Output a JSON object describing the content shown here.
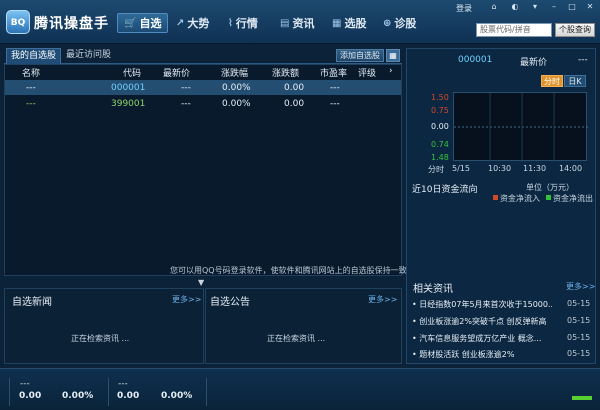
{
  "app": {
    "title": "腾讯操盘手",
    "logo_text": "BQ"
  },
  "topbar": {
    "login": "登录",
    "nav": [
      {
        "label": "自选",
        "icon": "cart"
      },
      {
        "label": "大势",
        "icon": "trend"
      },
      {
        "label": "行情",
        "icon": "chart"
      },
      {
        "label": "资讯",
        "icon": "news"
      },
      {
        "label": "选股",
        "icon": "grid"
      },
      {
        "label": "诊股",
        "icon": "plus"
      }
    ],
    "search_placeholder": "股票代码/拼音",
    "search_button": "个股查询"
  },
  "watchlist": {
    "tabs": [
      "我的自选股",
      "最近访问股"
    ],
    "add_button": "添加自选股",
    "columns": [
      "名称",
      "代码",
      "最新价",
      "涨跌幅",
      "涨跌额",
      "市盈率",
      "评级"
    ],
    "rows": [
      {
        "name": "---",
        "code": "000001",
        "price": "---",
        "pct": "0.00%",
        "chg": "0.00",
        "pe": "---",
        "rating": ""
      },
      {
        "name": "---",
        "code": "399001",
        "price": "---",
        "pct": "0.00%",
        "chg": "0.00",
        "pe": "---",
        "rating": ""
      }
    ],
    "hint": "您可以用QQ号码登录软件，使软件和腾讯网站上的自选股保持一致"
  },
  "quote": {
    "code": "000001",
    "label": "最新价",
    "value": "---",
    "tab_fenshi": "分时",
    "tab_rik": "日K",
    "y_labels": [
      "1.50",
      "0.75",
      "0.00",
      "0.74",
      "1.48"
    ],
    "x_labels": [
      "分时",
      "5/15",
      "10:30",
      "11:30",
      "14:00"
    ]
  },
  "fund_flow": {
    "title": "近10日资金流向",
    "unit": "单位（万元）",
    "legend_in": "资金净流入",
    "legend_out": "资金净流出",
    "color_in": "#d04a2a",
    "color_out": "#35c23a"
  },
  "news_self": {
    "title": "自选新闻",
    "more": "更多>>",
    "loading": "正在检索资讯 ..."
  },
  "announce_self": {
    "title": "自选公告",
    "more": "更多>>",
    "loading": "正在检索资讯 ..."
  },
  "related_news": {
    "title": "相关资讯",
    "more": "更多>>",
    "items": [
      {
        "text": "日经指数07年5月来首次收于15000...",
        "date": "05-15"
      },
      {
        "text": "创业板涨逾2%突破千点 创反弹新高",
        "date": "05-15"
      },
      {
        "text": "汽车信息服务望成万亿产业 概念...",
        "date": "05-15"
      },
      {
        "text": "题材股活跃 创业板涨逾2%",
        "date": "05-15"
      }
    ]
  },
  "indices": [
    {
      "name": "---",
      "value": "0.00",
      "pct": "0.00%"
    },
    {
      "name": "---",
      "value": "0.00",
      "pct": "0.00%"
    }
  ]
}
